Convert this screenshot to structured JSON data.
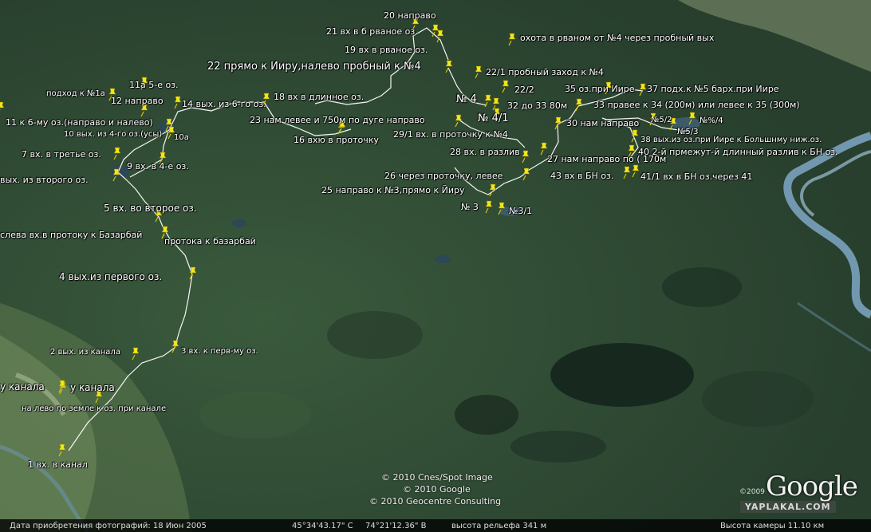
{
  "map": {
    "title": "",
    "copyrights": [
      "© 2010 Cnes/Spot Image",
      "© 2010 Google",
      "© 2010 Geocentre Consulting"
    ],
    "logo": "Google",
    "logo_year": "©2009",
    "watermark": "YAPLAKAL.COM",
    "colors": {
      "route": "#ffffff",
      "pin": "#f5e61a",
      "river": "#7ea8c4",
      "terrain": "#2f4a36"
    },
    "waypoints": [
      {
        "name": "20  направо"
      },
      {
        "name": "21  вх в б рваное оз."
      },
      {
        "name": "19  вх в рваное оз."
      },
      {
        "name": "охота в рваном от №4 через пробный вых"
      },
      {
        "name": "22 прямо к Ииру,налево пробный к №4"
      },
      {
        "name": "22/1 пробный заход к №4"
      },
      {
        "name": "22/2"
      },
      {
        "name": "35 оз.при Иире"
      },
      {
        "name": "37 подх.к №5 барх.при Иире"
      },
      {
        "name": "подход к №1а"
      },
      {
        "name": "11а  5-е оз."
      },
      {
        "name": "12   направо"
      },
      {
        "name": "14 вых. из 6-го оз."
      },
      {
        "name": "18 вх в длинное оз."
      },
      {
        "name": "№ 4"
      },
      {
        "name": "32 до 33 80м"
      },
      {
        "name": "33 правее к 34 (200м)  или левее к 35 (300м)"
      },
      {
        "name": "№ 4/1"
      },
      {
        "name": "11 к 6-му оз.(направо и налево)"
      },
      {
        "name": "23  нам левее и 750м по дуге направо"
      },
      {
        "name": "30 нам направо"
      },
      {
        "name": "№5/2"
      },
      {
        "name": "№%/4"
      },
      {
        "name": "10 вых. из 4-го оз.(усы)"
      },
      {
        "name": "10а"
      },
      {
        "name": "№5/3"
      },
      {
        "name": "29/1  вх. в проточку к №4"
      },
      {
        "name": "38 вых.из оз.при Иире к Большнму ниж.оз."
      },
      {
        "name": "16  вхю в проточку"
      },
      {
        "name": "7  вх. в третье оз."
      },
      {
        "name": "28 вх. в разлив"
      },
      {
        "name": "40   2-й прмежут-й длинный разлив к БН оз."
      },
      {
        "name": "27 нам направо по ( 170м"
      },
      {
        "name": "9 вх. в 4-е оз."
      },
      {
        "name": "вых. из второго оз."
      },
      {
        "name": "43 вх в БН оз."
      },
      {
        "name": "41/1 вх в БН оз.через 41"
      },
      {
        "name": "26 через проточку, левее"
      },
      {
        "name": "25 направо к №3,прямо к Йиру"
      },
      {
        "name": "№ 3"
      },
      {
        "name": "№3/1"
      },
      {
        "name": "5 вх. во второе оз."
      },
      {
        "name": "слева вх.в  протоку к Базарбай"
      },
      {
        "name": "протока к базарбай"
      },
      {
        "name": "4 вых.из первого оз."
      },
      {
        "name": "2 вых. из канала"
      },
      {
        "name": "3 вх. к перв-му оз."
      },
      {
        "name": "у канала"
      },
      {
        "name": "у канала"
      },
      {
        "name": "на лево по земле к оз. при канале"
      },
      {
        "name": "1 вх. в канал"
      }
    ]
  },
  "statusbar": {
    "date_label": "Дата приобретения фотографий: 18 Июн 2005",
    "lat": "45°34'43.17\" С",
    "lon": "74°21'12.36\" В",
    "elev": "высота рельефа  341 м",
    "camera": "Высота камеры    11.10 км"
  }
}
